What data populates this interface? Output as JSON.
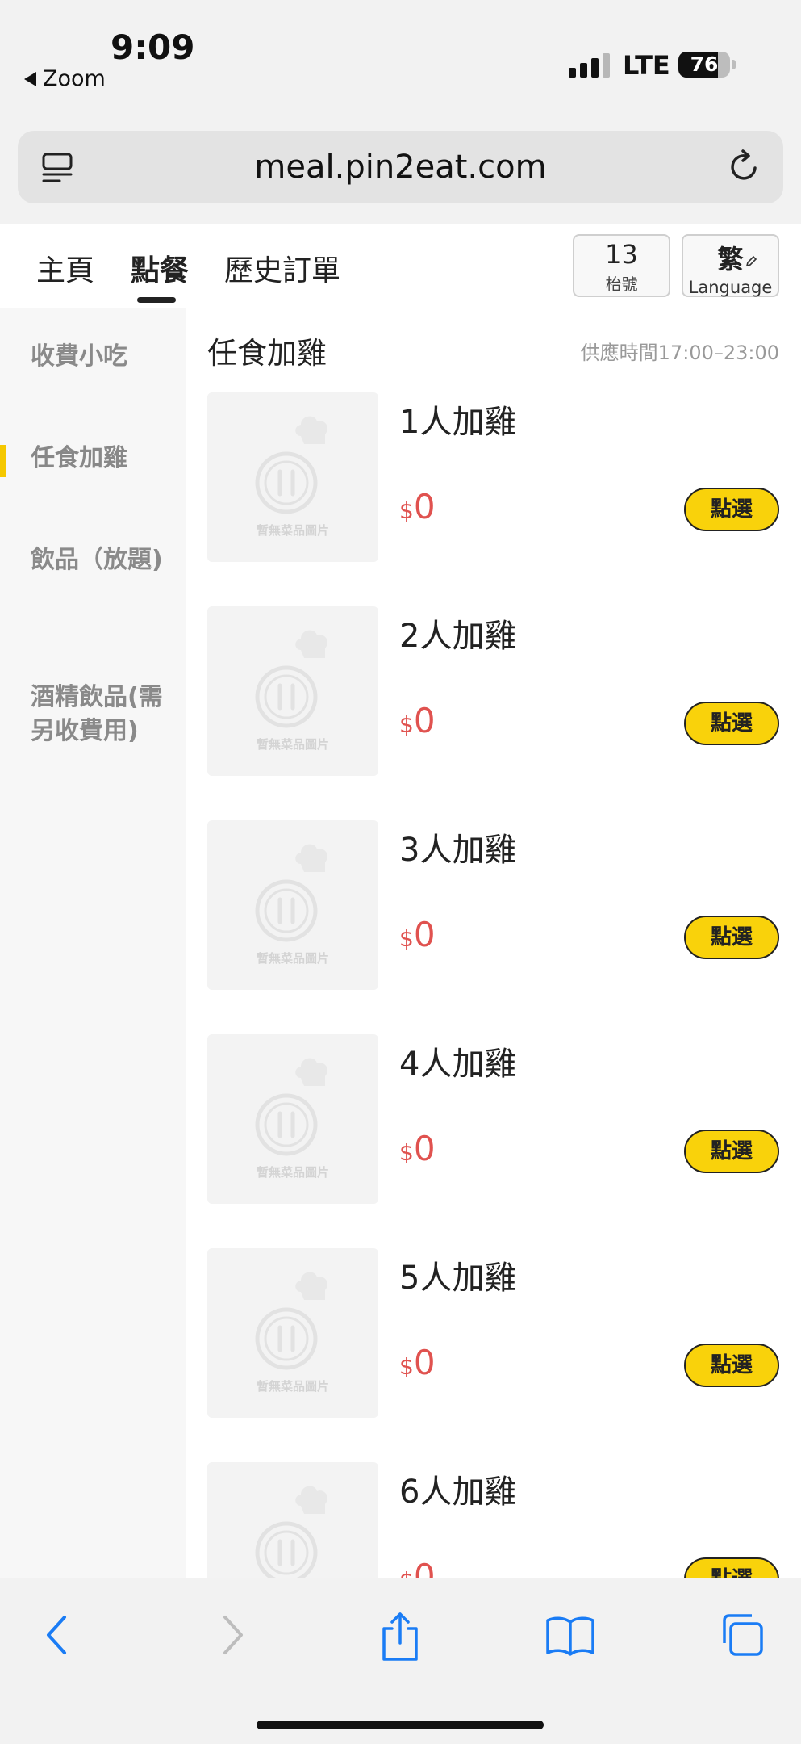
{
  "status": {
    "time": "9:09",
    "back_app": "Zoom",
    "network": "LTE",
    "battery": "76",
    "battery_level": 0.76
  },
  "browser": {
    "url": "meal.pin2eat.com"
  },
  "header": {
    "tabs": [
      "主頁",
      "點餐",
      "歷史訂單"
    ],
    "active_tab": "點餐",
    "table_number": "13",
    "table_label": "枱號",
    "language_char": "繁",
    "language_label": "Language"
  },
  "sidebar": {
    "categories": [
      "收費小吃",
      "任食加雞",
      "飲品（放題)",
      "酒精飲品(需另收費用)"
    ],
    "active_category": "任食加雞"
  },
  "main": {
    "section_title": "任食加雞",
    "serve_time": "供應時間17:00–23:00",
    "placeholder_text": "暫無菜品圖片",
    "currency": "$",
    "select_label": "點選",
    "items": [
      {
        "name": "1人加雞",
        "price": "0"
      },
      {
        "name": "2人加雞",
        "price": "0"
      },
      {
        "name": "3人加雞",
        "price": "0"
      },
      {
        "name": "4人加雞",
        "price": "0"
      },
      {
        "name": "5人加雞",
        "price": "0"
      },
      {
        "name": "6人加雞",
        "price": "0"
      }
    ]
  },
  "colors": {
    "accent": "#f9d20b",
    "price": "#e0524f",
    "ios_blue": "#1a7cf5",
    "marker": "#f5c800"
  },
  "toolbar_icons": [
    "chevron-left-icon",
    "chevron-right-icon",
    "share-icon",
    "bookmarks-icon",
    "tabs-icon"
  ]
}
